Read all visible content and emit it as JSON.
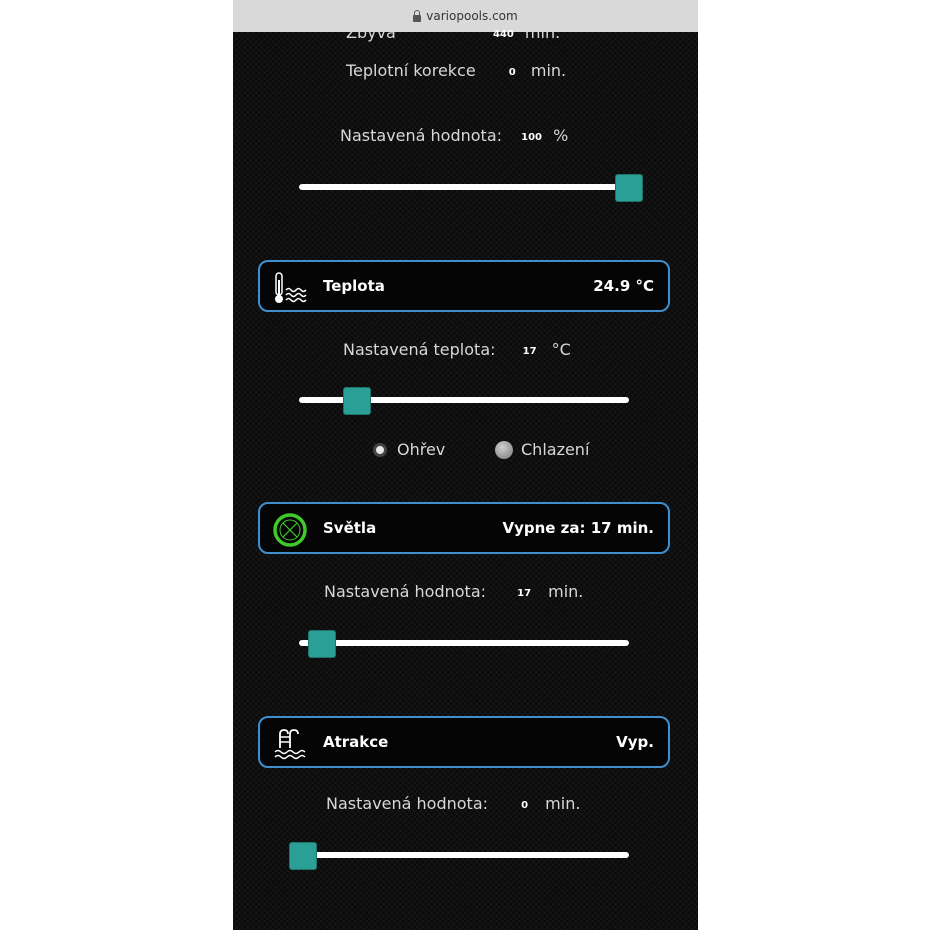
{
  "browser": {
    "url": "variopools.com"
  },
  "top_partial": {
    "label": "Zbývá",
    "value": "440",
    "unit": "min."
  },
  "temp_correction": {
    "label": "Teplotní korekce",
    "value": "0",
    "unit": "min."
  },
  "filtration": {
    "setpoint_label": "Nastavená hodnota:",
    "value": "100",
    "unit": "%",
    "slider_fraction": 1.0
  },
  "temperature": {
    "title": "Teplota",
    "reading": "24.9 °C",
    "setpoint_label": "Nastavená teplota:",
    "value": "17",
    "unit": "°C",
    "mode_options": [
      "Ohřev",
      "Chlazení"
    ],
    "selected_mode": "Ohřev"
  },
  "lights": {
    "title": "Světla",
    "status": "Vypne za: 17 min.",
    "setpoint_label": "Nastavená hodnota:",
    "value": "17",
    "unit": "min."
  },
  "attractions": {
    "title": "Atrakce",
    "status": "Vyp.",
    "setpoint_label": "Nastavená hodnota:",
    "value": "0",
    "unit": "min."
  },
  "colors": {
    "accent": "#2a9f95",
    "card_border": "#3d8fd0",
    "lights_icon": "#3ecb2a"
  },
  "icons": {
    "lock": "lock-icon",
    "temperature": "thermometer-water-icon",
    "lights": "light-circle-icon",
    "attractions": "pool-ladder-icon"
  }
}
